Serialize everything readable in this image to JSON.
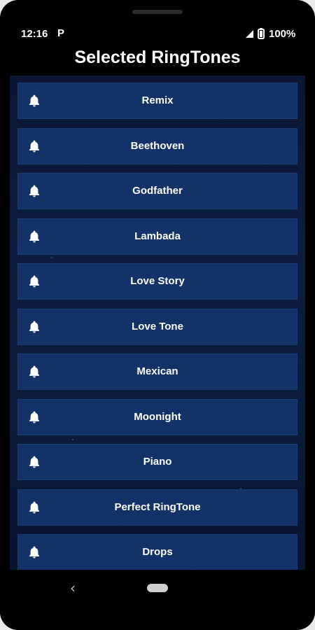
{
  "status": {
    "time": "12:16",
    "notification_icon": "P",
    "battery": "100%"
  },
  "title": "Selected RingTones",
  "ringtones": [
    {
      "label": "Remix"
    },
    {
      "label": "Beethoven"
    },
    {
      "label": "Godfather"
    },
    {
      "label": "Lambada"
    },
    {
      "label": "Love Story"
    },
    {
      "label": "Love Tone"
    },
    {
      "label": "Mexican"
    },
    {
      "label": "Moonight"
    },
    {
      "label": "Piano"
    },
    {
      "label": "Perfect RingTone"
    },
    {
      "label": "Drops"
    }
  ],
  "icons": {
    "item_icon": "bell-icon",
    "back": "back-chevron-icon",
    "home": "home-pill-icon",
    "signal": "signal-icon",
    "battery": "battery-icon"
  },
  "colors": {
    "background": "#000000",
    "item_background": "#14376e",
    "text": "#ffffff"
  },
  "nav": {
    "back_glyph": "‹"
  }
}
